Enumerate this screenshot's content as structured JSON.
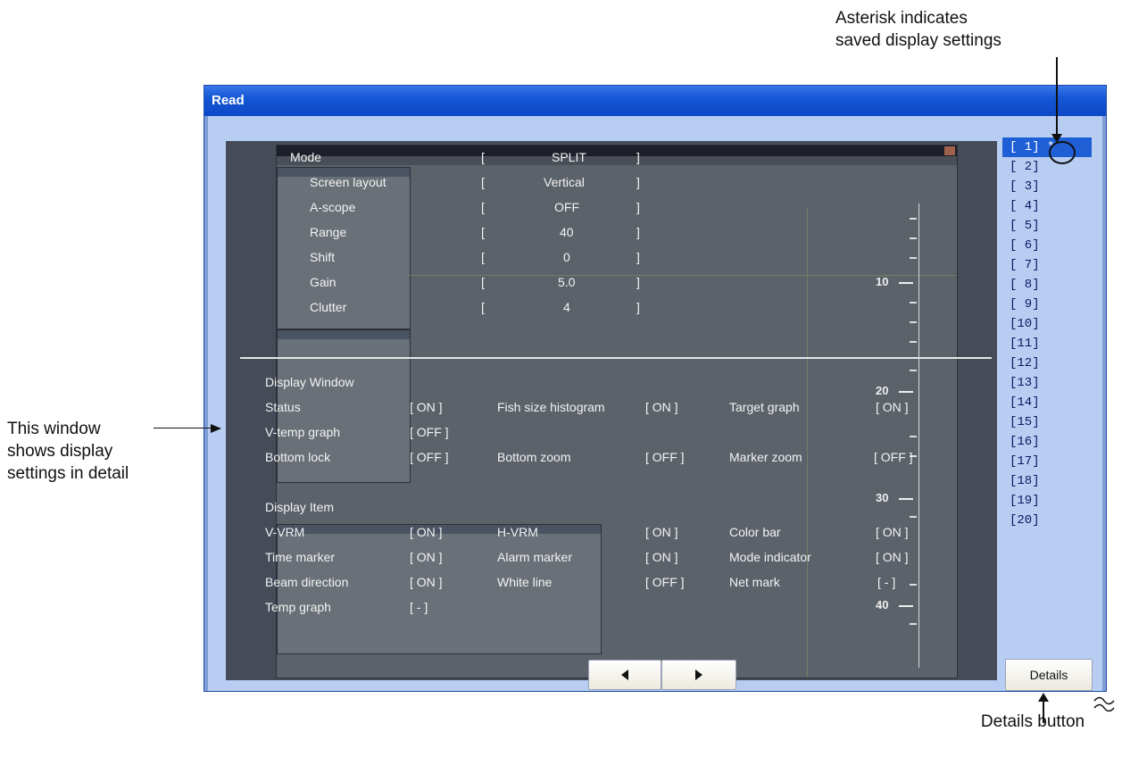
{
  "callouts": {
    "asterisk": [
      "Asterisk indicates",
      "saved display settings"
    ],
    "window": [
      "This window",
      "shows display",
      "settings in detail"
    ],
    "details": "Details button"
  },
  "dialog": {
    "title": "Read"
  },
  "settings": {
    "mode": {
      "label": "Mode",
      "value": "SPLIT"
    },
    "screen_layout": {
      "label": "Screen layout",
      "value": "Vertical"
    },
    "a_scope": {
      "label": "A-scope",
      "value": "OFF"
    },
    "range": {
      "label": "Range",
      "value": "40"
    },
    "shift": {
      "label": "Shift",
      "value": "0"
    },
    "gain": {
      "label": "Gain",
      "value": "5.0"
    },
    "clutter": {
      "label": "Clutter",
      "value": "4"
    }
  },
  "display_window": {
    "heading": "Display Window",
    "status": {
      "label": "Status",
      "value": "[ ON ]"
    },
    "fish_size_histogram": {
      "label": "Fish size histogram",
      "value": "[ ON ]"
    },
    "target_graph": {
      "label": "Target graph",
      "value": "[ ON ]"
    },
    "v_temp_graph": {
      "label": "V-temp graph",
      "value": "[ OFF ]"
    },
    "bottom_lock": {
      "label": "Bottom lock",
      "value": "[ OFF ]"
    },
    "bottom_zoom": {
      "label": "Bottom zoom",
      "value": "[ OFF ]"
    },
    "marker_zoom": {
      "label": "Marker zoom",
      "value": "[ OFF ]"
    }
  },
  "display_item": {
    "heading": "Display Item",
    "v_vrm": {
      "label": "V-VRM",
      "value": "[ ON ]"
    },
    "h_vrm": {
      "label": "H-VRM",
      "value": "[ ON ]"
    },
    "color_bar": {
      "label": "Color bar",
      "value": "[ ON ]"
    },
    "time_marker": {
      "label": "Time marker",
      "value": "[ ON ]"
    },
    "alarm_marker": {
      "label": "Alarm marker",
      "value": "[ ON ]"
    },
    "mode_indicator": {
      "label": "Mode indicator",
      "value": "[ ON ]"
    },
    "beam_direction": {
      "label": "Beam direction",
      "value": "[ ON ]"
    },
    "white_line": {
      "label": "White line",
      "value": "[ OFF ]"
    },
    "net_mark": {
      "label": "Net mark",
      "value": "[ - ]"
    },
    "temp_graph": {
      "label": "Temp graph",
      "value": "[ - ]"
    }
  },
  "depth_scale": [
    "10",
    "20",
    "30",
    "40"
  ],
  "memory_list": {
    "items": [
      "[ 1]",
      "[ 2]",
      "[ 3]",
      "[ 4]",
      "[ 5]",
      "[ 6]",
      "[ 7]",
      "[ 8]",
      "[ 9]",
      "[10]",
      "[11]",
      "[12]",
      "[13]",
      "[14]",
      "[15]",
      "[16]",
      "[17]",
      "[18]",
      "[19]",
      "[20]"
    ],
    "selected_index": 0,
    "saved_mark": "*"
  },
  "buttons": {
    "prev_icon": "triangle-left-icon",
    "next_icon": "triangle-right-icon",
    "details": "Details"
  },
  "colors": {
    "title_bar": "#1457d6",
    "client": "#b7cdf1",
    "selected": "#1f5fd6",
    "preview": "#454c58"
  }
}
